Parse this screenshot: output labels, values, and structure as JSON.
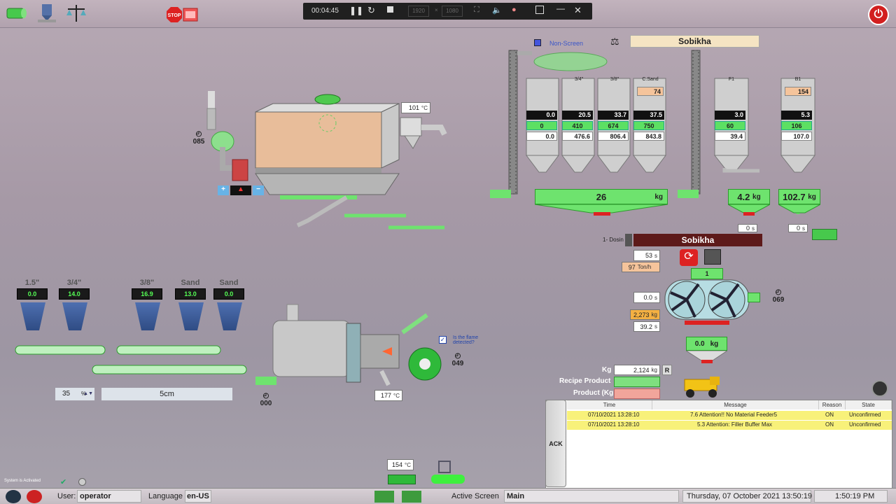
{
  "recorder": {
    "time": "00:04:45",
    "width": "1920",
    "height": "1080"
  },
  "header": {
    "stop_label": "STOP",
    "power_label": "⏻"
  },
  "silos": [
    {
      "name": "",
      "percent": "0.0",
      "target": "0",
      "actual": "0.0",
      "temp": ""
    },
    {
      "name": "3/4\"",
      "percent": "20.5",
      "target": "410",
      "actual": "476.6",
      "temp": ""
    },
    {
      "name": "3/8\"",
      "percent": "33.7",
      "target": "674",
      "actual": "806.4",
      "temp": ""
    },
    {
      "name": "C.Sand",
      "percent": "37.5",
      "target": "750",
      "actual": "843.8",
      "temp": "74"
    },
    {
      "name": "F1",
      "percent": "3.0",
      "target": "60",
      "actual": "39.4",
      "temp": ""
    },
    {
      "name": "B1",
      "percent": "5.3",
      "target": "106",
      "actual": "107.0",
      "temp": "154"
    }
  ],
  "units": {
    "pct": "%",
    "kg": "kg",
    "degc": "°C",
    "s": "s",
    "tonh": "Ton/h"
  },
  "non_screen": "Non-Screen",
  "recipe_name": "Sobikha",
  "recipe_bar": {
    "label": "1- Dosin",
    "name": "Sobikha"
  },
  "scales": {
    "agg_kg": "26",
    "filler_kg": "4.2",
    "bitumen_kg": "102.7",
    "f_s": "0",
    "b_s": "0"
  },
  "mixer": {
    "time_s": "53",
    "rate": "97",
    "count": "1",
    "wait_s": "0.0",
    "total_kg": "2,273",
    "ext": "39.2",
    "gauge": "069",
    "out_kg": "0.0"
  },
  "dryer": {
    "temp": "101",
    "gauge": "085"
  },
  "burner": {
    "temp": "177",
    "gauge": "049",
    "fan_gauge": "000",
    "flame_q": "Is the flame detected?"
  },
  "cold_feed": [
    {
      "name": "1.5\"",
      "pct": "0.0"
    },
    {
      "name": "3/4\"",
      "pct": "14.0"
    },
    {
      "name": "3/8\"",
      "pct": "16.9"
    },
    {
      "name": "Sand",
      "pct": "13.0"
    },
    {
      "name": "Sand",
      "pct": "0.0"
    }
  ],
  "feed_rate": "35",
  "feed_size": "5cm",
  "product": {
    "kg_label": "Kg",
    "kg_value": "2,124",
    "recipe_label": "Recipe Product",
    "product_label": "Product (Kg",
    "r": "R"
  },
  "bitumen_tank_temp": "154",
  "alarms": {
    "ack": "ACK",
    "headers": [
      "Time",
      "Message",
      "Reason",
      "State"
    ],
    "rows": [
      {
        "time": "07/10/2021 13:28:10",
        "message": "7.6 Attention!! No Material Feeder5",
        "reason": "ON",
        "state": "Unconfirmed"
      },
      {
        "time": "07/10/2021 13:28:10",
        "message": "5.3 Attention: Filler Buffer Max",
        "reason": "ON",
        "state": "Unconfirmed"
      }
    ]
  },
  "status": {
    "activated": "System is Activated"
  },
  "footer": {
    "user_label": "User:",
    "user": "operator",
    "lang_label": "Language",
    "lang": "en-US",
    "active_label": "Active Screen",
    "screen": "Main",
    "datetime": "Thursday, 07 October 2021 13:50:19",
    "clock": "1:50:19 PM"
  }
}
